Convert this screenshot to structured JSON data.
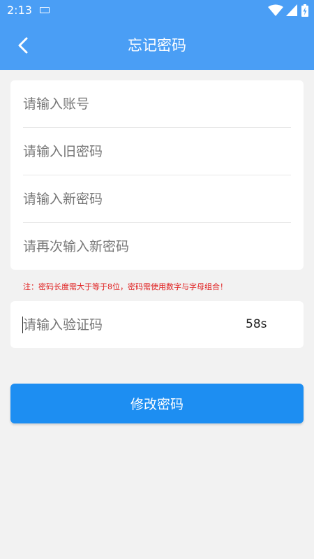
{
  "status_bar": {
    "time": "2:13",
    "icons": [
      "keyboard-icon",
      "wifi-icon",
      "signal-icon",
      "battery-icon"
    ]
  },
  "app_bar": {
    "title": "忘记密码",
    "back_icon": "chevron-left-icon",
    "background": "#4a9ef5"
  },
  "form": {
    "account_placeholder": "请输入账号",
    "old_password_placeholder": "请输入旧密码",
    "new_password_placeholder": "请输入新密码",
    "confirm_password_placeholder": "请再次输入新密码",
    "note": "注：密码长度需大于等于8位，密码需使用数字与字母组合！",
    "verification_code_placeholder": "请输入验证码",
    "countdown": "58s",
    "submit_label": "修改密码"
  },
  "colors": {
    "accent": "#1d8ef2",
    "warning": "#e02020",
    "background": "#f2f2f2"
  }
}
